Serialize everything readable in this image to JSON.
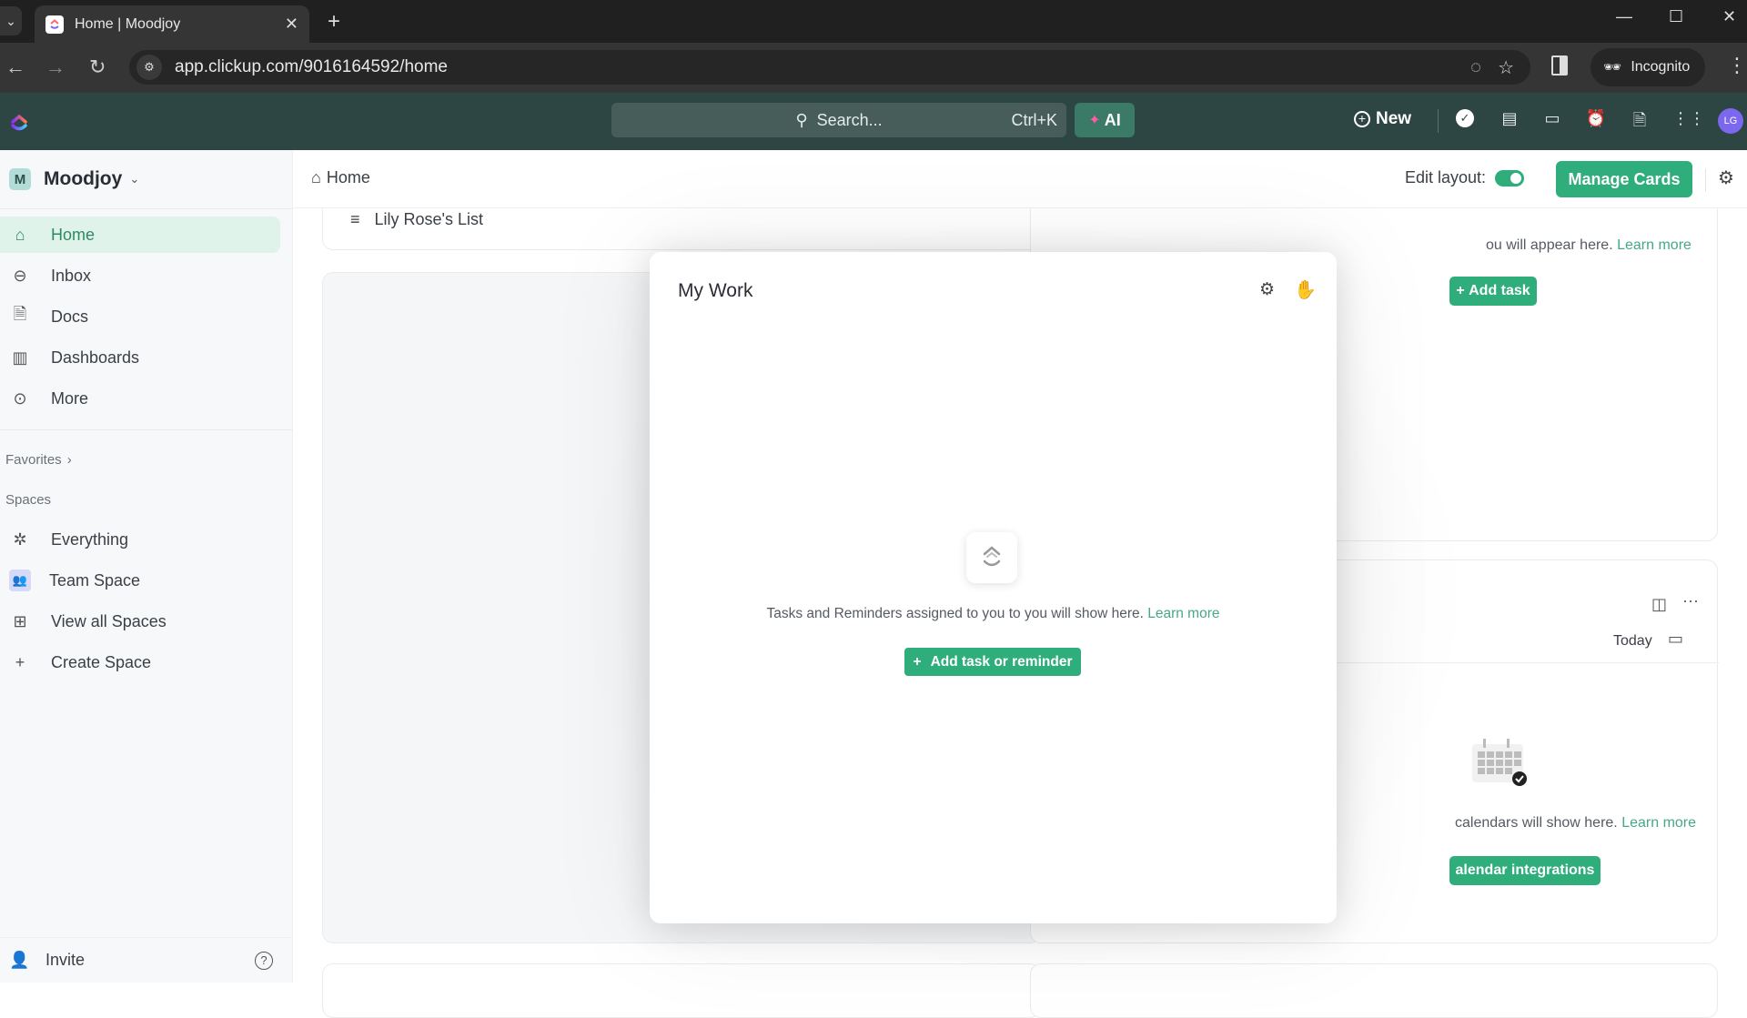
{
  "browser": {
    "tab_title": "Home | Moodjoy",
    "url": "app.clickup.com/9016164592/home",
    "incognito_label": "Incognito"
  },
  "appbar": {
    "search_placeholder": "Search...",
    "search_shortcut": "Ctrl+K",
    "ai_label": "AI",
    "new_label": "New",
    "avatar_initials": "LG"
  },
  "sidebar": {
    "workspace_initial": "M",
    "workspace_name": "Moodjoy",
    "nav": [
      {
        "label": "Home",
        "icon": "home-icon",
        "active": true
      },
      {
        "label": "Inbox",
        "icon": "inbox-icon"
      },
      {
        "label": "Docs",
        "icon": "docs-icon"
      },
      {
        "label": "Dashboards",
        "icon": "dashboards-icon"
      },
      {
        "label": "More",
        "icon": "more-icon"
      }
    ],
    "favorites_label": "Favorites",
    "spaces_label": "Spaces",
    "spaces": [
      {
        "label": "Everything",
        "icon": "everything-icon"
      },
      {
        "label": "Team Space",
        "icon": "team-icon"
      },
      {
        "label": "View all Spaces",
        "icon": "grid-icon"
      },
      {
        "label": "Create Space",
        "icon": "plus-icon"
      }
    ],
    "invite_label": "Invite"
  },
  "header": {
    "breadcrumb": "Home",
    "edit_layout_label": "Edit layout:",
    "edit_layout_on": true,
    "manage_cards_label": "Manage Cards"
  },
  "cards": {
    "list_item": "Lily Rose's List",
    "assigned_text_fragment": "ou will appear here.",
    "learn_more": "Learn more",
    "add_task_label": "Add task",
    "today_label": "Today",
    "calendar_text_fragment": "calendars will show here.",
    "calendar_button_fragment": "alendar integrations"
  },
  "my_work": {
    "title": "My Work",
    "empty_text": "Tasks and Reminders assigned to you to you will show here.",
    "learn_more": "Learn more",
    "add_button": "Add task or reminder"
  },
  "colors": {
    "accent": "#2fae7c",
    "appbar": "#2d4644",
    "active_nav_bg": "#dff3ea",
    "link": "#45a889"
  }
}
